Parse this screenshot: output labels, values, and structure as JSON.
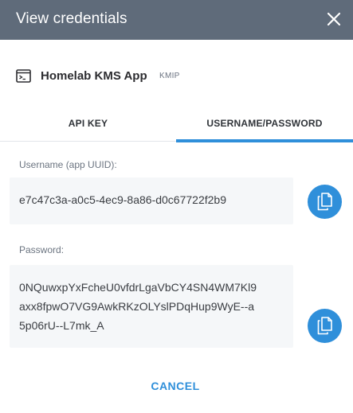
{
  "dialog": {
    "title": "View credentials",
    "close_icon": "close-icon"
  },
  "app": {
    "icon": "terminal-window-icon",
    "name": "Homelab KMS App",
    "badge": "KMIP"
  },
  "tabs": [
    {
      "label": "API KEY",
      "active": false
    },
    {
      "label": "USERNAME/PASSWORD",
      "active": true
    }
  ],
  "username": {
    "label": "Username (app UUID):",
    "value": "e7c47c3a-a0c5-4ec9-8a86-d0c67722f2b9",
    "copy_icon": "copy-icon"
  },
  "password": {
    "label": "Password:",
    "lines": [
      "0NQuwxpYxFcheU0vfdrLgaVbCY4SN4WM7Kl9",
      "axx8fpwO7VG9AwkRKzOLYslPDqHup9WyE--a",
      "5p06rU--L7mk_A"
    ],
    "copy_icon": "copy-icon"
  },
  "footer": {
    "cancel_label": "CANCEL"
  },
  "colors": {
    "header_bg": "#5f6b7a",
    "accent": "#2f8fda",
    "field_bg": "#f5f7f9"
  }
}
